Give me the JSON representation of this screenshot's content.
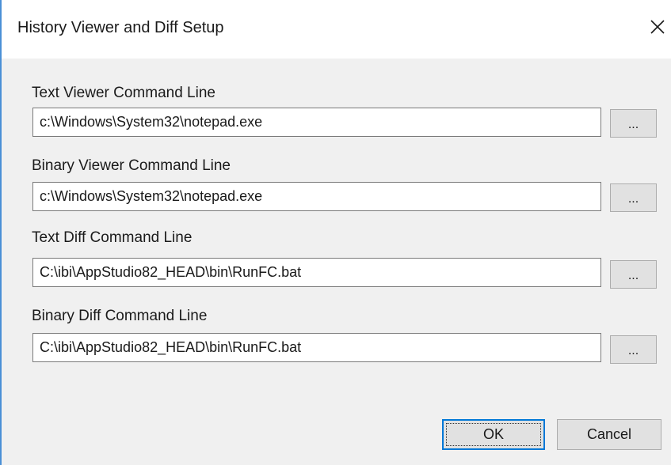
{
  "window": {
    "title": "History Viewer and Diff Setup",
    "close_icon": "close-icon"
  },
  "fields": [
    {
      "label": "Text Viewer Command Line",
      "value": "c:\\Windows\\System32\\notepad.exe",
      "browse_label": "..."
    },
    {
      "label": "Binary Viewer Command Line",
      "value": "c:\\Windows\\System32\\notepad.exe",
      "browse_label": "..."
    },
    {
      "label": "Text Diff Command Line",
      "value": "C:\\ibi\\AppStudio82_HEAD\\bin\\RunFC.bat",
      "browse_label": "..."
    },
    {
      "label": "Binary Diff Command Line",
      "value": "C:\\ibi\\AppStudio82_HEAD\\bin\\RunFC.bat",
      "browse_label": "..."
    }
  ],
  "buttons": {
    "ok_label": "OK",
    "cancel_label": "Cancel"
  },
  "colors": {
    "accent": "#0078d7",
    "window_border": "#4a90d6",
    "dialog_background": "#f0f0f0",
    "titlebar_background": "#ffffff"
  }
}
